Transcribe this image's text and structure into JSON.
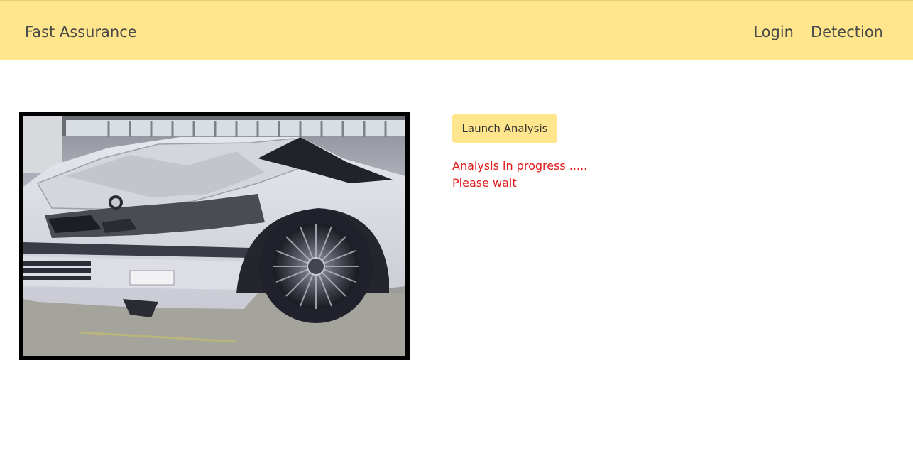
{
  "navbar": {
    "brand": "Fast Assurance",
    "links": [
      "Login",
      "Detection"
    ],
    "background": "#ffe68c"
  },
  "main": {
    "image": {
      "icon": "damaged-car-photo",
      "description_alt": "car image"
    },
    "launch_button": "Launch Analysis",
    "status_lines": [
      "Analysis in progress .....",
      "Please wait"
    ],
    "status_color": "#e31a1a"
  }
}
